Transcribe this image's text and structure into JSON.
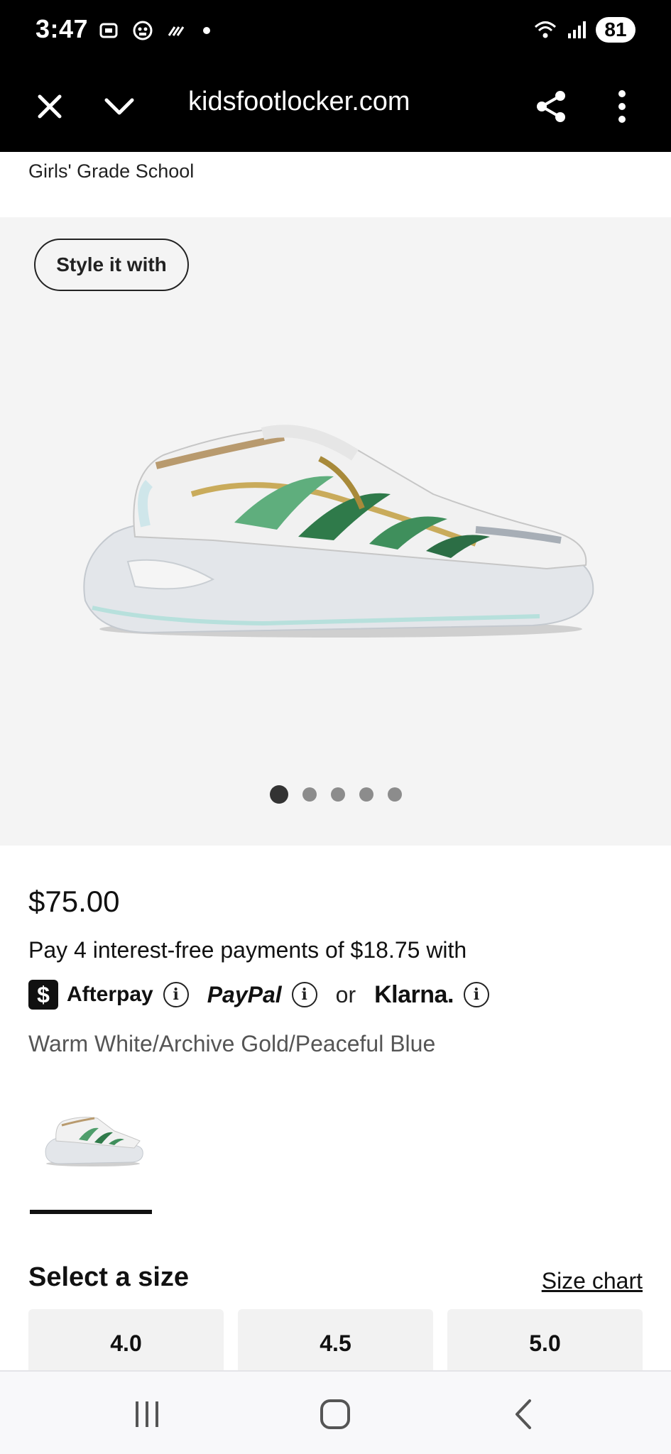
{
  "status_bar": {
    "time": "3:47",
    "battery": "81",
    "icons": [
      "screenshot-icon",
      "media-icon",
      "data-icon",
      "notification-dot",
      "wifi-icon",
      "signal-icon",
      "battery-icon"
    ]
  },
  "browser": {
    "url": "kidsfootlocker.com",
    "close_icon": "close-icon",
    "chevron_icon": "chevron-down-icon",
    "share_icon": "share-icon",
    "menu_icon": "more-vert-icon"
  },
  "product": {
    "breadcrumb": "Girls' Grade School",
    "style_button": "Style it with",
    "gallery_dots": 5,
    "active_dot": 1,
    "price": "$75.00",
    "installments": "Pay 4 interest-free payments of $18.75 with",
    "payment": {
      "afterpay_badge": "$",
      "afterpay": "Afterpay",
      "paypal": "PayPal",
      "or": "or",
      "klarna": "Klarna.",
      "info_glyph": "i"
    },
    "colorway": "Warm White/Archive Gold/Peaceful Blue"
  },
  "sizes": {
    "title": "Select a size",
    "size_chart": "Size chart",
    "options": [
      "4.0",
      "4.5",
      "5.0"
    ]
  },
  "colors": {
    "bar_bg": "#000000",
    "gallery_bg": "#f4f4f4",
    "size_btn_bg": "#f2f2f2"
  }
}
